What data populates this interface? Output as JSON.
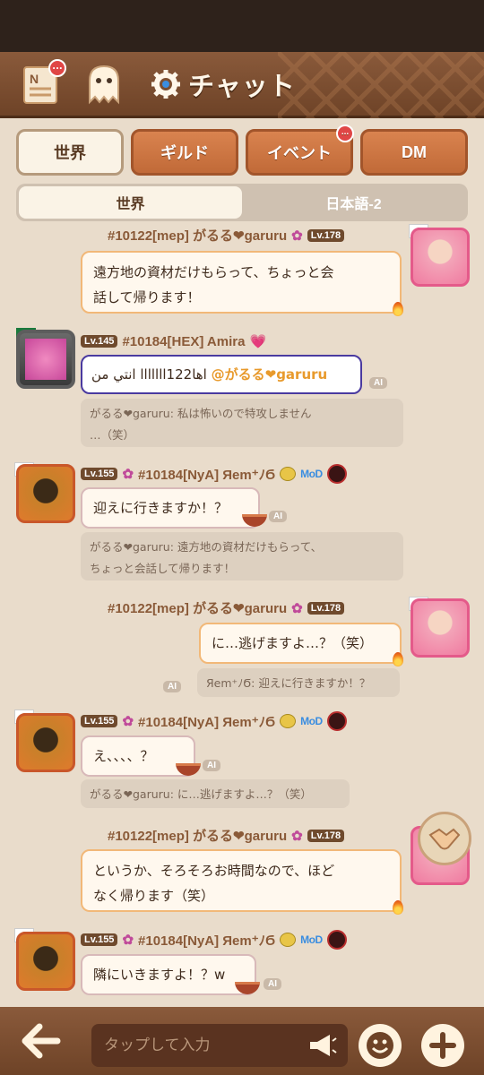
{
  "header": {
    "title": "チャット",
    "news_badge": "...",
    "news_icon": "news-scroll-icon",
    "ghost_icon": "ghost-icon",
    "gear_icon": "gear-icon"
  },
  "tabs": [
    {
      "label": "世界",
      "active": true
    },
    {
      "label": "ギルド",
      "active": false
    },
    {
      "label": "イベント",
      "active": false,
      "badge": "..."
    },
    {
      "label": "DM",
      "active": false
    }
  ],
  "subtabs": [
    {
      "label": "世界",
      "active": true
    },
    {
      "label": "日本語-2",
      "active": false
    }
  ],
  "messages": [
    {
      "name": "#10122[mep] がるる❤garuru",
      "level": "Lv.178",
      "text_1": "遠方地の資材だけもらって、ちょっと会",
      "text_2": "話して帰ります！"
    },
    {
      "name": "#10184[HEX] Amira",
      "level": "Lv.145",
      "mention": "@がるる❤garuru",
      "text_ar": "انتي من lllllllاها122",
      "reply_1": "がるる❤garuru: 私は怖いので特攻しません",
      "reply_2": "…（笑）",
      "ai": "AI"
    },
    {
      "name": "#10184[NyA] Яem⁺ﾉϬ",
      "level": "Lv.155",
      "badge": "MoD",
      "text": "迎えに行きますか！？",
      "reply_1": "がるる❤garuru: 遠方地の資材だけもらって、",
      "reply_2": "ちょっと会話して帰ります！",
      "ai": "AI"
    },
    {
      "name": "#10122[mep] がるる❤garuru",
      "level": "Lv.178",
      "text": "に…逃げますよ…？（笑）",
      "reply": "Яem⁺ﾉϬ: 迎えに行きますか！？",
      "ai": "AI"
    },
    {
      "name": "#10184[NyA] Яem⁺ﾉϬ",
      "level": "Lv.155",
      "badge": "MoD",
      "text": "え、、、、？",
      "reply": "がるる❤garuru: に…逃げますよ…？（笑）",
      "ai": "AI"
    },
    {
      "name": "#10122[mep] がるる❤garuru",
      "level": "Lv.178",
      "text_1": "というか、そろそろお時間なので、ほど",
      "text_2": "なく帰ります（笑）"
    },
    {
      "name": "#10184[NyA] Яem⁺ﾉϬ",
      "level": "Lv.155",
      "badge": "MoD",
      "text": "隣にいきますよ！？w",
      "ai": "AI"
    }
  ],
  "input": {
    "placeholder": "タップして入力"
  },
  "colors": {
    "header": "#7a4a2e",
    "tab": "#c96f3c",
    "background": "#e9dccb",
    "bubble_border": "#f2b878"
  }
}
